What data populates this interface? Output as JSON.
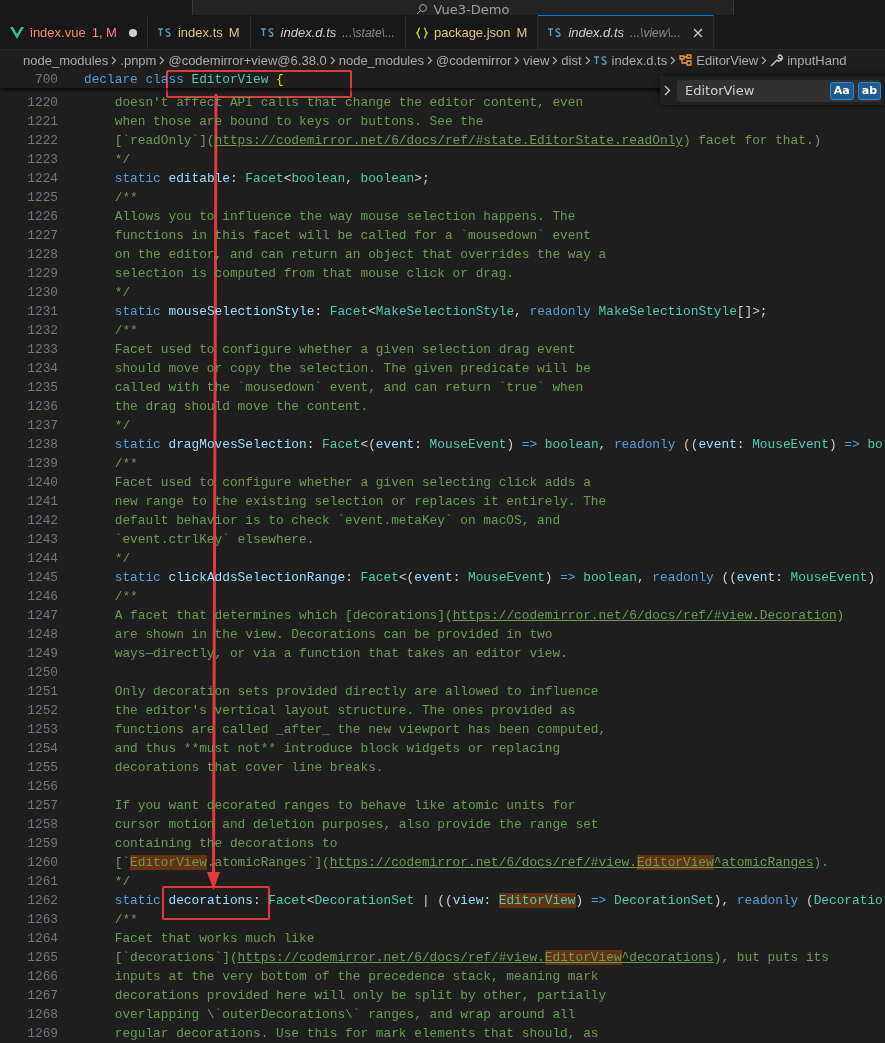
{
  "title_bar": {
    "search": "Vue3-Demo"
  },
  "tabs": [
    {
      "kind": "vue",
      "label": "index.vue",
      "badge": "1, M",
      "problem": true,
      "dirty": true,
      "preview": false,
      "selected": false
    },
    {
      "kind": "ts",
      "label": "index.ts",
      "badge": "M",
      "problem": false,
      "dirty": false,
      "preview": false,
      "selected": false
    },
    {
      "kind": "ts",
      "label": "index.d.ts",
      "detail": "...\\state\\...",
      "problem": false,
      "dirty": false,
      "preview": true,
      "selected": false
    },
    {
      "kind": "json",
      "label": "package.json",
      "badge": "M",
      "problem": false,
      "dirty": false,
      "preview": false,
      "selected": false
    },
    {
      "kind": "ts",
      "label": "index.d.ts",
      "detail": "...\\view\\...",
      "problem": false,
      "dirty": false,
      "preview": true,
      "selected": true
    }
  ],
  "breadcrumbs": [
    {
      "kind": "folder",
      "label": "node_modules"
    },
    {
      "kind": "folder",
      "label": ".pnpm"
    },
    {
      "kind": "folder",
      "label": "@codemirror+view@6.38.0"
    },
    {
      "kind": "folder",
      "label": "node_modules"
    },
    {
      "kind": "folder",
      "label": "@codemirror"
    },
    {
      "kind": "folder",
      "label": "view"
    },
    {
      "kind": "folder",
      "label": "dist"
    },
    {
      "kind": "file",
      "label": "index.d.ts"
    },
    {
      "kind": "class",
      "label": "EditorView"
    },
    {
      "kind": "method",
      "label": "inputHand"
    }
  ],
  "find_widget": {
    "value": "EditorView",
    "options": [
      {
        "label": "Aa",
        "on": true
      },
      {
        "label": "ab",
        "on": true
      }
    ]
  },
  "sticky_line": {
    "number": "700",
    "tokens": [
      {
        "kind": "keyword",
        "text": "declare "
      },
      {
        "kind": "keyword",
        "text": "class "
      },
      {
        "kind": "type",
        "text": "EditorView"
      },
      {
        "kind": "brace",
        "text": " {"
      }
    ]
  },
  "lines": [
    {
      "number": "1220",
      "kind": "comment",
      "text": "    doesn't affect API calls that change the editor content, even"
    },
    {
      "number": "1221",
      "kind": "comment",
      "text": "    when those are bound to keys or buttons. See the"
    },
    {
      "number": "1222",
      "kind": "code",
      "tokens": [
        {
          "kind": "comment",
          "text": "    [`readOnly`]("
        },
        {
          "kind": "link",
          "text": "https://codemirror.net/6/docs/ref/#state.EditorState.readOnly"
        },
        {
          "kind": "comment",
          "text": ") facet for that.)"
        }
      ]
    },
    {
      "number": "1223",
      "kind": "comment",
      "text": "    */"
    },
    {
      "number": "1224",
      "kind": "code",
      "tokens": [
        {
          "kind": "keyword",
          "text": "    static "
        },
        {
          "kind": "property",
          "text": "editable"
        },
        {
          "kind": "plain",
          "text": ": "
        },
        {
          "kind": "type",
          "text": "Facet"
        },
        {
          "kind": "plain",
          "text": "<"
        },
        {
          "kind": "type",
          "text": "boolean"
        },
        {
          "kind": "plain",
          "text": ", "
        },
        {
          "kind": "type",
          "text": "boolean"
        },
        {
          "kind": "plain",
          "text": ">;"
        }
      ]
    },
    {
      "number": "1225",
      "kind": "comment",
      "text": "    /**"
    },
    {
      "number": "1226",
      "kind": "comment",
      "text": "    Allows you to influence the way mouse selection happens. The"
    },
    {
      "number": "1227",
      "kind": "comment",
      "text": "    functions in this facet will be called for a `mousedown` event"
    },
    {
      "number": "1228",
      "kind": "comment",
      "text": "    on the editor, and can return an object that overrides the way a"
    },
    {
      "number": "1229",
      "kind": "comment",
      "text": "    selection is computed from that mouse click or drag."
    },
    {
      "number": "1230",
      "kind": "comment",
      "text": "    */"
    },
    {
      "number": "1231",
      "kind": "code",
      "tokens": [
        {
          "kind": "keyword",
          "text": "    static "
        },
        {
          "kind": "property",
          "text": "mouseSelectionStyle"
        },
        {
          "kind": "plain",
          "text": ": "
        },
        {
          "kind": "type",
          "text": "Facet"
        },
        {
          "kind": "plain",
          "text": "<"
        },
        {
          "kind": "type",
          "text": "MakeSelectionStyle"
        },
        {
          "kind": "plain",
          "text": ", "
        },
        {
          "kind": "keyword",
          "text": "readonly "
        },
        {
          "kind": "type",
          "text": "MakeSelectionStyle"
        },
        {
          "kind": "plain",
          "text": "[]>;"
        }
      ]
    },
    {
      "number": "1232",
      "kind": "comment",
      "text": "    /**"
    },
    {
      "number": "1233",
      "kind": "comment",
      "text": "    Facet used to configure whether a given selection drag event"
    },
    {
      "number": "1234",
      "kind": "comment",
      "text": "    should move or copy the selection. The given predicate will be"
    },
    {
      "number": "1235",
      "kind": "comment",
      "text": "    called with the `mousedown` event, and can return `true` when"
    },
    {
      "number": "1236",
      "kind": "comment",
      "text": "    the drag should move the content."
    },
    {
      "number": "1237",
      "kind": "comment",
      "text": "    */"
    },
    {
      "number": "1238",
      "kind": "code",
      "tokens": [
        {
          "kind": "keyword",
          "text": "    static "
        },
        {
          "kind": "property",
          "text": "dragMovesSelection"
        },
        {
          "kind": "plain",
          "text": ": "
        },
        {
          "kind": "type",
          "text": "Facet"
        },
        {
          "kind": "plain",
          "text": "<("
        },
        {
          "kind": "param",
          "text": "event"
        },
        {
          "kind": "plain",
          "text": ": "
        },
        {
          "kind": "type",
          "text": "MouseEvent"
        },
        {
          "kind": "plain",
          "text": ") "
        },
        {
          "kind": "keyword",
          "text": "=> "
        },
        {
          "kind": "type",
          "text": "boolean"
        },
        {
          "kind": "plain",
          "text": ", "
        },
        {
          "kind": "keyword",
          "text": "readonly "
        },
        {
          "kind": "plain",
          "text": "(("
        },
        {
          "kind": "param",
          "text": "event"
        },
        {
          "kind": "plain",
          "text": ": "
        },
        {
          "kind": "type",
          "text": "MouseEvent"
        },
        {
          "kind": "plain",
          "text": ") "
        },
        {
          "kind": "keyword",
          "text": "=> "
        },
        {
          "kind": "type",
          "text": "bo"
        }
      ]
    },
    {
      "number": "1239",
      "kind": "comment",
      "text": "    /**"
    },
    {
      "number": "1240",
      "kind": "comment",
      "text": "    Facet used to configure whether a given selecting click adds a"
    },
    {
      "number": "1241",
      "kind": "comment",
      "text": "    new range to the existing selection or replaces it entirely. The"
    },
    {
      "number": "1242",
      "kind": "comment",
      "text": "    default behavior is to check `event.metaKey` on macOS, and"
    },
    {
      "number": "1243",
      "kind": "comment",
      "text": "    `event.ctrlKey` elsewhere."
    },
    {
      "number": "1244",
      "kind": "comment",
      "text": "    */"
    },
    {
      "number": "1245",
      "kind": "code",
      "tokens": [
        {
          "kind": "keyword",
          "text": "    static "
        },
        {
          "kind": "property",
          "text": "clickAddsSelectionRange"
        },
        {
          "kind": "plain",
          "text": ": "
        },
        {
          "kind": "type",
          "text": "Facet"
        },
        {
          "kind": "plain",
          "text": "<("
        },
        {
          "kind": "param",
          "text": "event"
        },
        {
          "kind": "plain",
          "text": ": "
        },
        {
          "kind": "type",
          "text": "MouseEvent"
        },
        {
          "kind": "plain",
          "text": ") "
        },
        {
          "kind": "keyword",
          "text": "=> "
        },
        {
          "kind": "type",
          "text": "boolean"
        },
        {
          "kind": "plain",
          "text": ", "
        },
        {
          "kind": "keyword",
          "text": "readonly "
        },
        {
          "kind": "plain",
          "text": "(("
        },
        {
          "kind": "param",
          "text": "event"
        },
        {
          "kind": "plain",
          "text": ": "
        },
        {
          "kind": "type",
          "text": "MouseEvent"
        },
        {
          "kind": "plain",
          "text": ")"
        }
      ]
    },
    {
      "number": "1246",
      "kind": "comment",
      "text": "    /**"
    },
    {
      "number": "1247",
      "kind": "code",
      "tokens": [
        {
          "kind": "comment",
          "text": "    A facet that determines which [decorations]("
        },
        {
          "kind": "link",
          "text": "https://codemirror.net/6/docs/ref/#view.Decoration"
        },
        {
          "kind": "comment",
          "text": ")"
        }
      ]
    },
    {
      "number": "1248",
      "kind": "comment",
      "text": "    are shown in the view. Decorations can be provided in two"
    },
    {
      "number": "1249",
      "kind": "comment",
      "text": "    ways—directly, or via a function that takes an editor view."
    },
    {
      "number": "1250",
      "kind": "blank"
    },
    {
      "number": "1251",
      "kind": "comment",
      "text": "    Only decoration sets provided directly are allowed to influence"
    },
    {
      "number": "1252",
      "kind": "comment",
      "text": "    the editor's vertical layout structure. The ones provided as"
    },
    {
      "number": "1253",
      "kind": "comment",
      "text": "    functions are called _after_ the new viewport has been computed,"
    },
    {
      "number": "1254",
      "kind": "comment",
      "text": "    and thus **must not** introduce block widgets or replacing"
    },
    {
      "number": "1255",
      "kind": "comment",
      "text": "    decorations that cover line breaks."
    },
    {
      "number": "1256",
      "kind": "blank"
    },
    {
      "number": "1257",
      "kind": "comment",
      "text": "    If you want decorated ranges to behave like atomic units for"
    },
    {
      "number": "1258",
      "kind": "comment",
      "text": "    cursor motion and deletion purposes, also provide the range set"
    },
    {
      "number": "1259",
      "kind": "comment",
      "text": "    containing the decorations to"
    },
    {
      "number": "1260",
      "kind": "code",
      "tokens": [
        {
          "kind": "comment",
          "text": "    [`"
        },
        {
          "kind": "comment",
          "text": "EditorView",
          "match": true
        },
        {
          "kind": "comment",
          "text": ".atomicRanges`]("
        },
        {
          "kind": "link",
          "text": "https://codemirror.net/6/docs/ref/#view."
        },
        {
          "kind": "link",
          "text": "EditorView",
          "match": true
        },
        {
          "kind": "link",
          "text": "^atomicRanges"
        },
        {
          "kind": "comment",
          "text": ")."
        }
      ]
    },
    {
      "number": "1261",
      "kind": "comment",
      "text": "    */"
    },
    {
      "number": "1262",
      "kind": "code",
      "tokens": [
        {
          "kind": "keyword",
          "text": "    static "
        },
        {
          "kind": "property",
          "text": "decorations"
        },
        {
          "kind": "plain",
          "text": ": "
        },
        {
          "kind": "type",
          "text": "Facet"
        },
        {
          "kind": "plain",
          "text": "<"
        },
        {
          "kind": "type",
          "text": "DecorationSet"
        },
        {
          "kind": "plain",
          "text": " | (("
        },
        {
          "kind": "param",
          "text": "view"
        },
        {
          "kind": "plain",
          "text": ": "
        },
        {
          "kind": "type",
          "text": "EditorView",
          "match": true
        },
        {
          "kind": "plain",
          "text": ") "
        },
        {
          "kind": "keyword",
          "text": "=> "
        },
        {
          "kind": "type",
          "text": "DecorationSet"
        },
        {
          "kind": "plain",
          "text": "), "
        },
        {
          "kind": "keyword",
          "text": "readonly "
        },
        {
          "kind": "plain",
          "text": "("
        },
        {
          "kind": "type",
          "text": "Decoratio"
        }
      ]
    },
    {
      "number": "1263",
      "kind": "comment",
      "text": "    /**"
    },
    {
      "number": "1264",
      "kind": "comment",
      "text": "    Facet that works much like"
    },
    {
      "number": "1265",
      "kind": "code",
      "tokens": [
        {
          "kind": "comment",
          "text": "    [`decorations`]("
        },
        {
          "kind": "link",
          "text": "https://codemirror.net/6/docs/ref/#view."
        },
        {
          "kind": "link",
          "text": "EditorView",
          "match": true
        },
        {
          "kind": "link",
          "text": "^decorations"
        },
        {
          "kind": "comment",
          "text": "), but puts its"
        }
      ]
    },
    {
      "number": "1266",
      "kind": "comment",
      "text": "    inputs at the very bottom of the precedence stack, meaning mark"
    },
    {
      "number": "1267",
      "kind": "comment",
      "text": "    decorations provided here will only be split by other, partially"
    },
    {
      "number": "1268",
      "kind": "comment",
      "text": "    overlapping \\`outerDecorations\\` ranges, and wrap around all"
    },
    {
      "number": "1269",
      "kind": "comment",
      "text": "    regular decorations. Use this for mark elements that should, as"
    }
  ],
  "annotations": [
    {
      "kind": "box"
    },
    {
      "kind": "box"
    },
    {
      "kind": "arrow"
    }
  ]
}
